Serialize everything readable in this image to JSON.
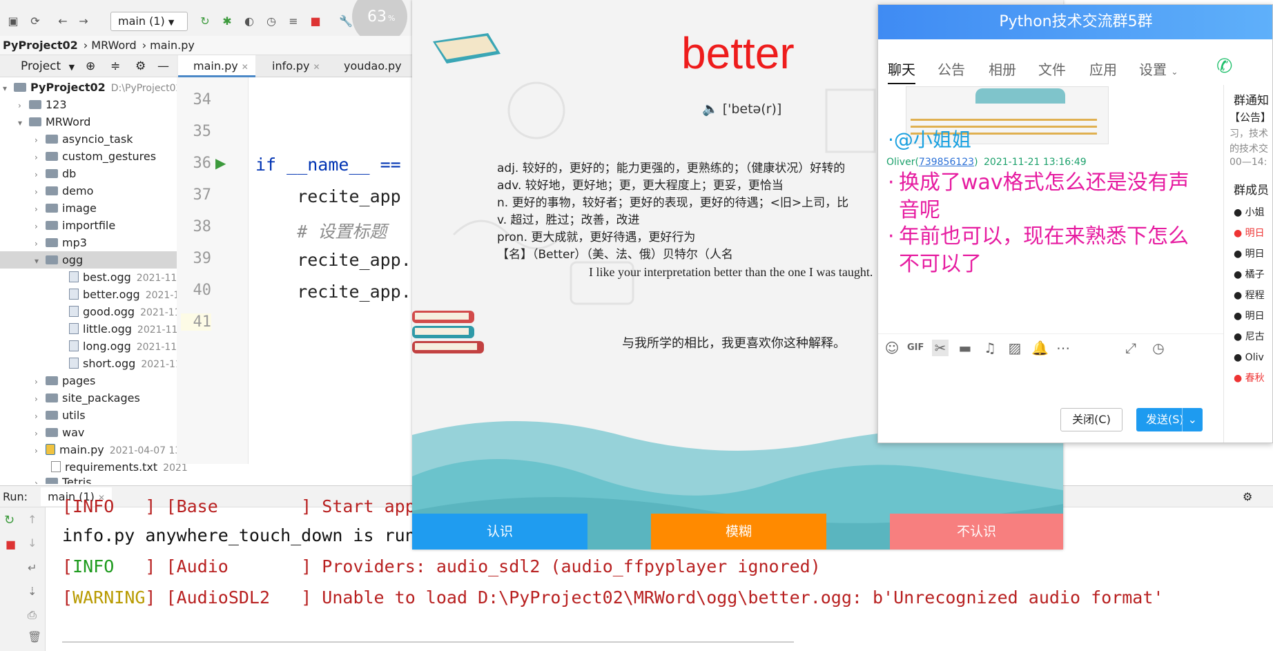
{
  "ide": {
    "run_config": "main (1)",
    "breadcrumbs": [
      "PyProject02",
      "MRWord",
      "main.py"
    ],
    "project_panel_label": "Project",
    "project_root": "PyProject02",
    "project_root_path": "D:\\PyProject02",
    "tree": [
      {
        "label": "123"
      },
      {
        "label": "MRWord"
      },
      {
        "label": "asyncio_task"
      },
      {
        "label": "custom_gestures"
      },
      {
        "label": "db"
      },
      {
        "label": "demo"
      },
      {
        "label": "image"
      },
      {
        "label": "importfile"
      },
      {
        "label": "mp3"
      },
      {
        "label": "ogg"
      },
      {
        "label": "best.ogg",
        "date": "2021-11-"
      },
      {
        "label": "better.ogg",
        "date": "2021-1"
      },
      {
        "label": "good.ogg",
        "date": "2021-11"
      },
      {
        "label": "little.ogg",
        "date": "2021-11-"
      },
      {
        "label": "long.ogg",
        "date": "2021-11-"
      },
      {
        "label": "short.ogg",
        "date": "2021-11"
      },
      {
        "label": "pages"
      },
      {
        "label": "site_packages"
      },
      {
        "label": "utils"
      },
      {
        "label": "wav"
      },
      {
        "label": "main.py",
        "date": "2021-04-07 13"
      },
      {
        "label": "requirements.txt",
        "date": "2021"
      },
      {
        "label": "Tetris"
      }
    ],
    "editor_tabs": [
      "main.py",
      "info.py",
      "youdao.py"
    ],
    "line_numbers": [
      "34",
      "35",
      "36",
      "37",
      "38",
      "39",
      "40",
      "41"
    ],
    "code_lines": [
      "",
      "",
      "if __name__ ==",
      "    recite_app",
      "    # 设置标题",
      "    recite_app.",
      "    recite_app.",
      ""
    ],
    "run_label": "Run:",
    "run_tab": "main (1)",
    "console": {
      "line1": "[INFO   ] [Base        ] Start app",
      "line2": "info.py anywhere_touch_down is run",
      "line3_tag": "INFO",
      "line3_rest": "   ] [Audio       ] Providers: audio_sdl2 (audio_ffpyplayer ignored)",
      "line4_tag": "WARNING",
      "line4_rest": "] [AudioSDL2   ] Unable to load D:\\PyProject02\\MRWord\\ogg\\better.ogg: b'Unrecognized audio format'"
    },
    "meter_value": "63",
    "meter_unit": "%"
  },
  "word_app": {
    "word": "better",
    "phonetic": "['betə(r)]",
    "definitions": [
      "adj. 较好的，更好的；能力更强的，更熟练的；（健康状况）好转的",
      "adv. 较好地，更好地；更，更大程度上；更妥，更恰当",
      "n. 更好的事物，较好者；更好的表现，更好的待遇；<旧>上司，比",
      "v. 超过，胜过；改善，改进",
      "pron. 更大成就，更好待遇，更好行为",
      "【名】（Better）（美、法、俄）贝特尔（人名"
    ],
    "example_en": "I like your interpretation better than the one I was taught.",
    "example_cn": "与我所学的相比，我更喜欢你这种解释。",
    "buttons": {
      "know": "认识",
      "vague": "模糊",
      "unknown": "不认识"
    },
    "colors": {
      "word": "#ee1c1c",
      "know": "#1f9cf0",
      "vague": "#ff8a00",
      "unknown": "#f77f7f",
      "wave": "#6bc3cc"
    }
  },
  "chat": {
    "title": "Python技术交流群5群",
    "tabs": [
      "聊天",
      "公告",
      "相册",
      "文件",
      "应用",
      "设置"
    ],
    "mention": "@小姐姐",
    "sender": "Oliver(",
    "sender_id": "739856123",
    "sender_close": ")",
    "timestamp": "2021-11-21 13:16:49",
    "message1": "换成了wav格式怎么还是没有声音呢",
    "message2": "年前也可以，现在来熟悉下怎么不可以了",
    "side_notice_title": "群通知",
    "side_notice_tag": "【公告】",
    "side_notice_line1": "习，技术",
    "side_notice_line2": "的技术交",
    "side_notice_time": "00—14:",
    "members_title": "群成员",
    "members": [
      "小姐",
      "明日",
      "明日",
      "橘子",
      "程程",
      "明日",
      "尼古",
      "Oliv",
      "春秋"
    ],
    "close_button": "关闭(C)",
    "send_button": "发送(S)"
  }
}
